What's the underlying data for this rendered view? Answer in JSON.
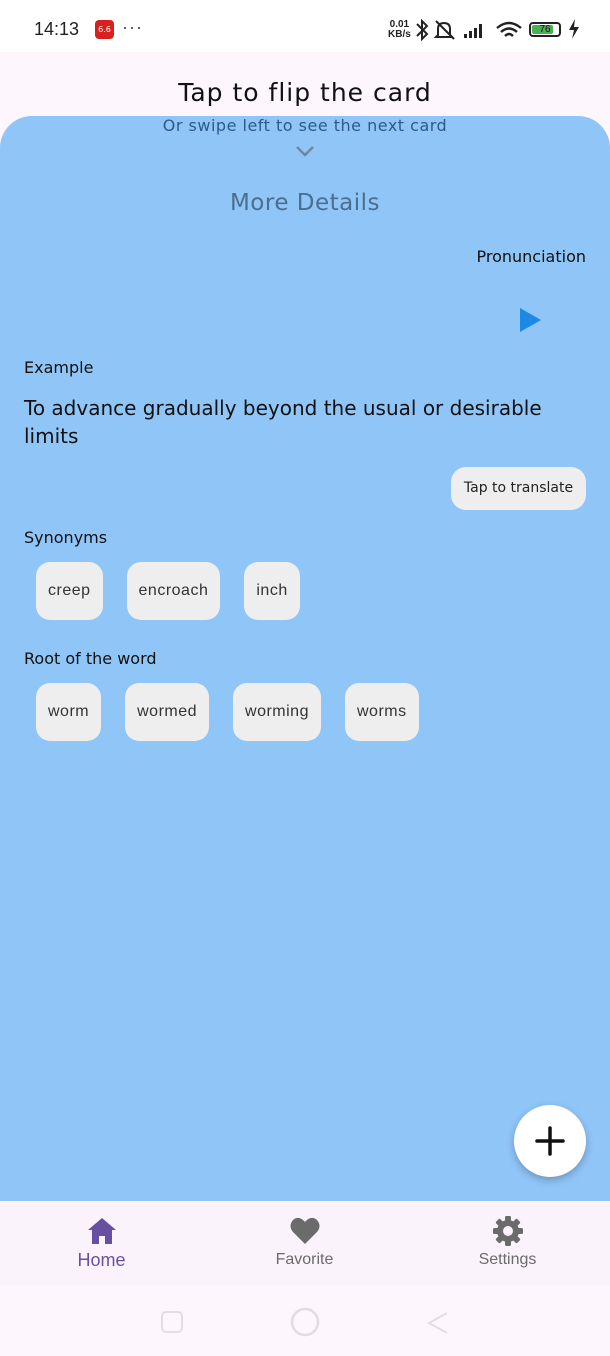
{
  "status_bar": {
    "time": "14:13",
    "app_badge": "6.6",
    "dots": "···",
    "speed_value": "0.01",
    "speed_unit": "KB/s",
    "battery": "76"
  },
  "header": {
    "title": "Tap to flip the card"
  },
  "card": {
    "subtitle": "Or swipe left to see the next card",
    "more_details": "More Details",
    "pronunciation_label": "Pronunciation",
    "example_label": "Example",
    "example_text": "To advance gradually beyond the usual or desirable limits",
    "translate_label": "Tap to translate",
    "synonyms_label": "Synonyms",
    "synonyms": [
      "creep",
      "encroach",
      "inch"
    ],
    "root_label": "Root of the word",
    "roots": [
      "worm",
      "wormed",
      "worming",
      "worms"
    ],
    "background_color": "#90c5f8"
  },
  "fab": {
    "icon": "plus-icon"
  },
  "bottom_nav": {
    "items": [
      {
        "label": "Home",
        "icon": "home-icon",
        "active": true
      },
      {
        "label": "Favorite",
        "icon": "heart-icon",
        "active": false
      },
      {
        "label": "Settings",
        "icon": "gear-icon",
        "active": false
      }
    ],
    "active_color": "#6750a4",
    "inactive_color": "#6b6b6b"
  }
}
